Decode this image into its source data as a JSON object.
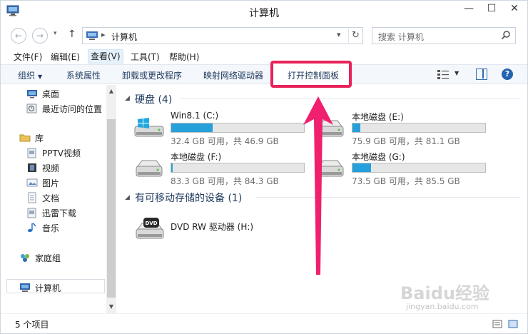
{
  "window": {
    "title": "计算机",
    "minimize": "—",
    "maximize": "☐",
    "close": "✕"
  },
  "address": {
    "path": "计算机",
    "search_placeholder": "搜索 计算机"
  },
  "menu": [
    "文件(F)",
    "编辑(E)",
    "查看(V)",
    "工具(T)",
    "帮助(H)"
  ],
  "commands": {
    "organize": "组织",
    "system_properties": "系统属性",
    "uninstall": "卸载或更改程序",
    "map_drive": "映射网络驱动器",
    "open_control_panel": "打开控制面板"
  },
  "nav_tree": {
    "desktop": "桌面",
    "recent": "最近访问的位置",
    "libraries": "库",
    "pptv": "PPTV视频",
    "videos": "视频",
    "pictures": "图片",
    "documents": "文档",
    "thunder": "迅雷下载",
    "music": "音乐",
    "homegroup": "家庭组",
    "computer": "计算机"
  },
  "groups": {
    "hard_disks": "硬盘 (4)",
    "removable": "有可移动存储的设备 (1)"
  },
  "drives": [
    {
      "name": "Win8.1 (C:)",
      "free": "32.4 GB 可用，共 46.9 GB",
      "used_fraction": 0.31
    },
    {
      "name": "本地磁盘 (E:)",
      "free": "75.9 GB 可用，共 81.1 GB",
      "used_fraction": 0.06
    },
    {
      "name": "本地磁盘 (F:)",
      "free": "83.3 GB 可用，共 84.3 GB",
      "used_fraction": 0.01
    },
    {
      "name": "本地磁盘 (G:)",
      "free": "73.5 GB 可用，共 85.5 GB",
      "used_fraction": 0.14
    }
  ],
  "dvd": {
    "name": "DVD RW 驱动器 (H:)",
    "badge": "DVD"
  },
  "status": {
    "items": "5 个项目"
  },
  "watermark": {
    "logo": "Baidu经验",
    "url": "jingyan.baidu.com"
  },
  "colors": {
    "highlight": "#e8245a",
    "drive_fill": "#26a0da"
  }
}
